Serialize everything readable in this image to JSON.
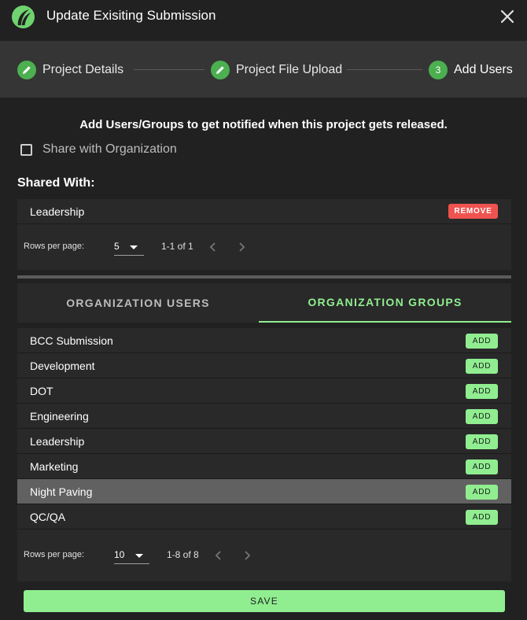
{
  "window": {
    "title": "Update Exisiting Submission",
    "logo_icon": "leaf-logo-icon",
    "close_icon": "close-icon"
  },
  "stepper": {
    "steps": [
      {
        "label": "Project Details",
        "icon": "pencil-icon",
        "state": "completed"
      },
      {
        "label": "Project File Upload",
        "icon": "pencil-icon",
        "state": "completed"
      },
      {
        "label": "Add Users",
        "number": "3",
        "state": "active"
      }
    ]
  },
  "main": {
    "heading": "Add Users/Groups to get notified when this project gets released.",
    "share_org_label": "Share with Organization",
    "share_org_checked": false,
    "shared_with_title": "Shared With:"
  },
  "shared": {
    "rows": [
      {
        "name": "Leadership",
        "action": "REMOVE"
      }
    ],
    "pagination": {
      "rows_per_page_label": "Rows per page:",
      "rows_per_page": "5",
      "range": "1-1 of 1"
    }
  },
  "tabs": {
    "users": "ORGANIZATION USERS",
    "groups": "ORGANIZATION GROUPS",
    "active": "groups"
  },
  "groups": {
    "rows": [
      {
        "name": "BCC Submission",
        "action": "ADD"
      },
      {
        "name": "Development",
        "action": "ADD"
      },
      {
        "name": "DOT",
        "action": "ADD"
      },
      {
        "name": "Engineering",
        "action": "ADD"
      },
      {
        "name": "Leadership",
        "action": "ADD"
      },
      {
        "name": "Marketing",
        "action": "ADD"
      },
      {
        "name": "Night Paving",
        "action": "ADD"
      },
      {
        "name": "QC/QA",
        "action": "ADD"
      }
    ],
    "highlighted_row": "Night Paving",
    "pagination": {
      "rows_per_page_label": "Rows per page:",
      "rows_per_page": "10",
      "range": "1-8 of 8"
    }
  },
  "footer": {
    "save_label": "SAVE"
  },
  "colors": {
    "accent_green": "#90ee90",
    "step_green": "#4caf50",
    "danger_red": "#ef5350",
    "background": "#212121",
    "panel": "#292929"
  }
}
